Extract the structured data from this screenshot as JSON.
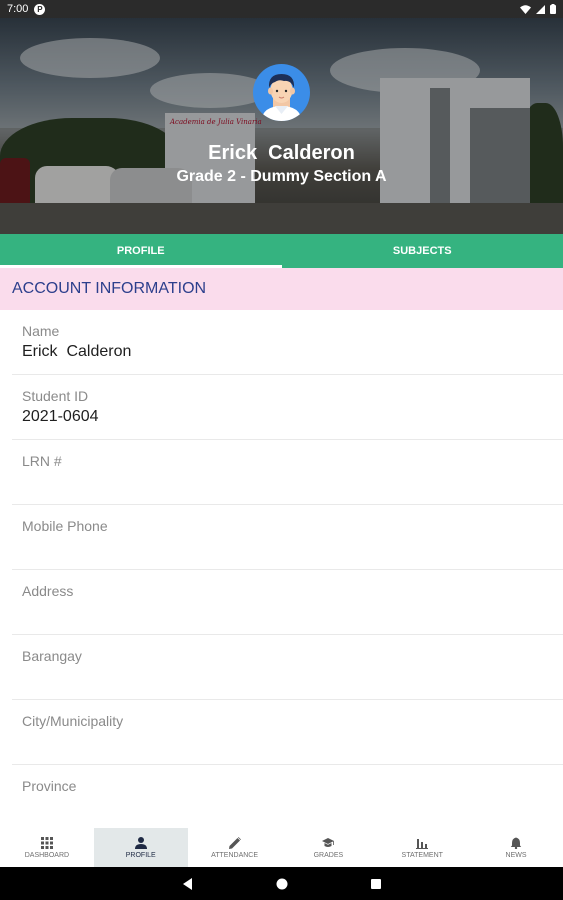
{
  "status_bar": {
    "time": "7:00",
    "app_icon_letter": "P",
    "icons": [
      "wifi-icon",
      "signal-icon",
      "battery-icon"
    ]
  },
  "profile_header": {
    "name": "Erick  Calderon",
    "section": "Grade 2 - Dummy Section A",
    "sign_text": "Academia de Julia Vinaria"
  },
  "tabs": [
    {
      "label": "PROFILE",
      "active": true
    },
    {
      "label": "SUBJECTS",
      "active": false
    }
  ],
  "account_info": {
    "heading": "ACCOUNT INFORMATION",
    "fields": [
      {
        "label": "Name",
        "value": "Erick  Calderon"
      },
      {
        "label": "Student ID",
        "value": "2021-0604"
      },
      {
        "label": "LRN #",
        "value": ""
      },
      {
        "label": "Mobile Phone",
        "value": ""
      },
      {
        "label": "Address",
        "value": ""
      },
      {
        "label": "Barangay",
        "value": ""
      },
      {
        "label": "City/Municipality",
        "value": ""
      },
      {
        "label": "Province",
        "value": ""
      }
    ]
  },
  "bottom_nav": [
    {
      "label": "DASHBOARD",
      "icon": "grid-icon",
      "active": false
    },
    {
      "label": "PROFILE",
      "icon": "person-icon",
      "active": true
    },
    {
      "label": "ATTENDANCE",
      "icon": "pencil-icon",
      "active": false
    },
    {
      "label": "GRADES",
      "icon": "graduation-cap-icon",
      "active": false
    },
    {
      "label": "STATEMENT",
      "icon": "bar-chart-icon",
      "active": false
    },
    {
      "label": "NEWS",
      "icon": "bell-icon",
      "active": false
    }
  ],
  "colors": {
    "accent_green": "#35b380",
    "section_header_bg": "#fadcec",
    "section_header_text": "#2c3f8c",
    "avatar_bg": "#3b8de8"
  }
}
